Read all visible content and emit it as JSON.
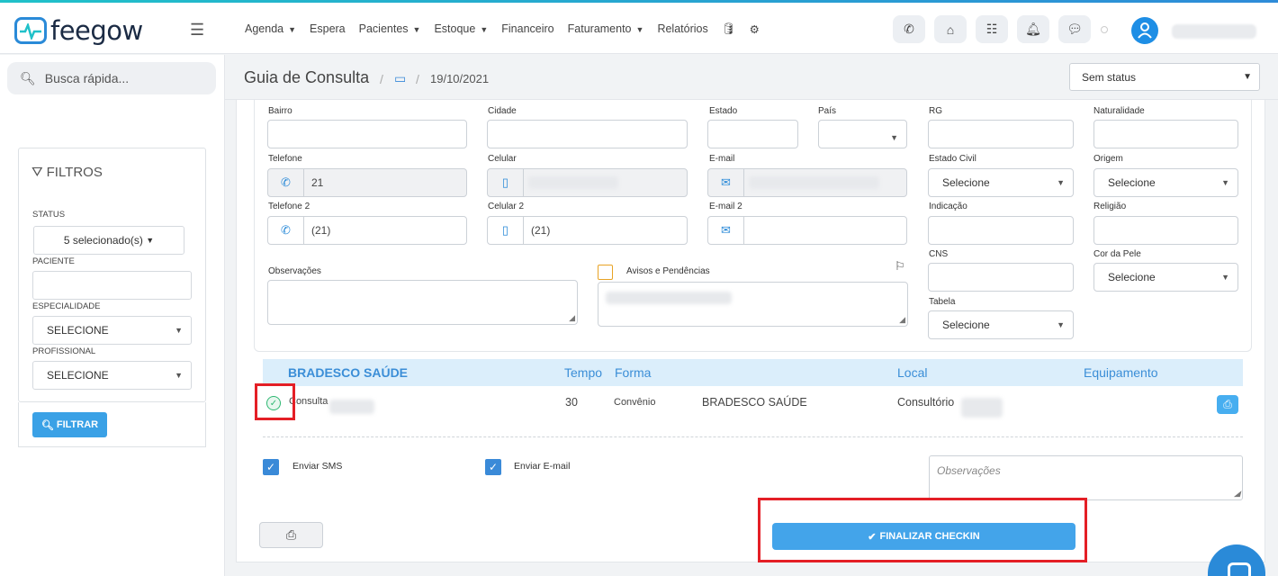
{
  "app": {
    "name": "feegow"
  },
  "nav": {
    "items": [
      {
        "label": "Agenda",
        "caret": true
      },
      {
        "label": "Espera",
        "caret": false
      },
      {
        "label": "Pacientes",
        "caret": true
      },
      {
        "label": "Estoque",
        "caret": true
      },
      {
        "label": "Financeiro",
        "caret": false
      },
      {
        "label": "Faturamento",
        "caret": true
      },
      {
        "label": "Relatórios",
        "caret": false
      }
    ]
  },
  "sidebar": {
    "search_placeholder": "Busca rápida...",
    "filters_title": "FILTROS",
    "status_label": "STATUS",
    "status_value": "5 selecionado(s)",
    "paciente_label": "PACIENTE",
    "especialidade_label": "ESPECIALIDADE",
    "especialidade_value": "SELECIONE",
    "profissional_label": "PROFISSIONAL",
    "profissional_value": "SELECIONE",
    "filter_button": "FILTRAR"
  },
  "breadcrumb": {
    "title": "Guia de Consulta",
    "date": "19/10/2021",
    "status": "Sem status"
  },
  "form": {
    "bairro": "Bairro",
    "cidade": "Cidade",
    "estado": "Estado",
    "pais": "País",
    "rg": "RG",
    "naturalidade": "Naturalidade",
    "telefone": "Telefone",
    "telefone_value": "21",
    "celular": "Celular",
    "email": "E-mail",
    "estado_civil": "Estado Civil",
    "estado_civil_value": "Selecione",
    "origem": "Origem",
    "origem_value": "Selecione",
    "telefone2": "Telefone 2",
    "telefone2_value": "(21)",
    "celular2": "Celular 2",
    "celular2_value": "(21)",
    "email2": "E-mail 2",
    "indicacao": "Indicação",
    "religiao": "Religião",
    "observacoes": "Observações",
    "avisos": "Avisos e Pendências",
    "cns": "CNS",
    "cor_pele": "Cor da Pele",
    "cor_pele_value": "Selecione",
    "tabela": "Tabela",
    "tabela_value": "Selecione"
  },
  "table": {
    "headers": {
      "convenio": "BRADESCO SAÚDE",
      "tempo": "Tempo",
      "forma": "Forma",
      "local": "Local",
      "equipamento": "Equipamento"
    },
    "row": {
      "procedimento": "Consulta",
      "tempo": "30",
      "forma": "Convênio",
      "convenio": "BRADESCO SAÚDE",
      "local": "Consultório"
    }
  },
  "footer": {
    "sms": "Enviar SMS",
    "email": "Enviar E-mail",
    "obs_placeholder": "Observações",
    "finalize": "FINALIZAR CHECKIN"
  },
  "colors": {
    "accent": "#2a8ad8",
    "button": "#43a4ea",
    "highlight": "#e41f26",
    "table_header": "#dbeefb"
  }
}
